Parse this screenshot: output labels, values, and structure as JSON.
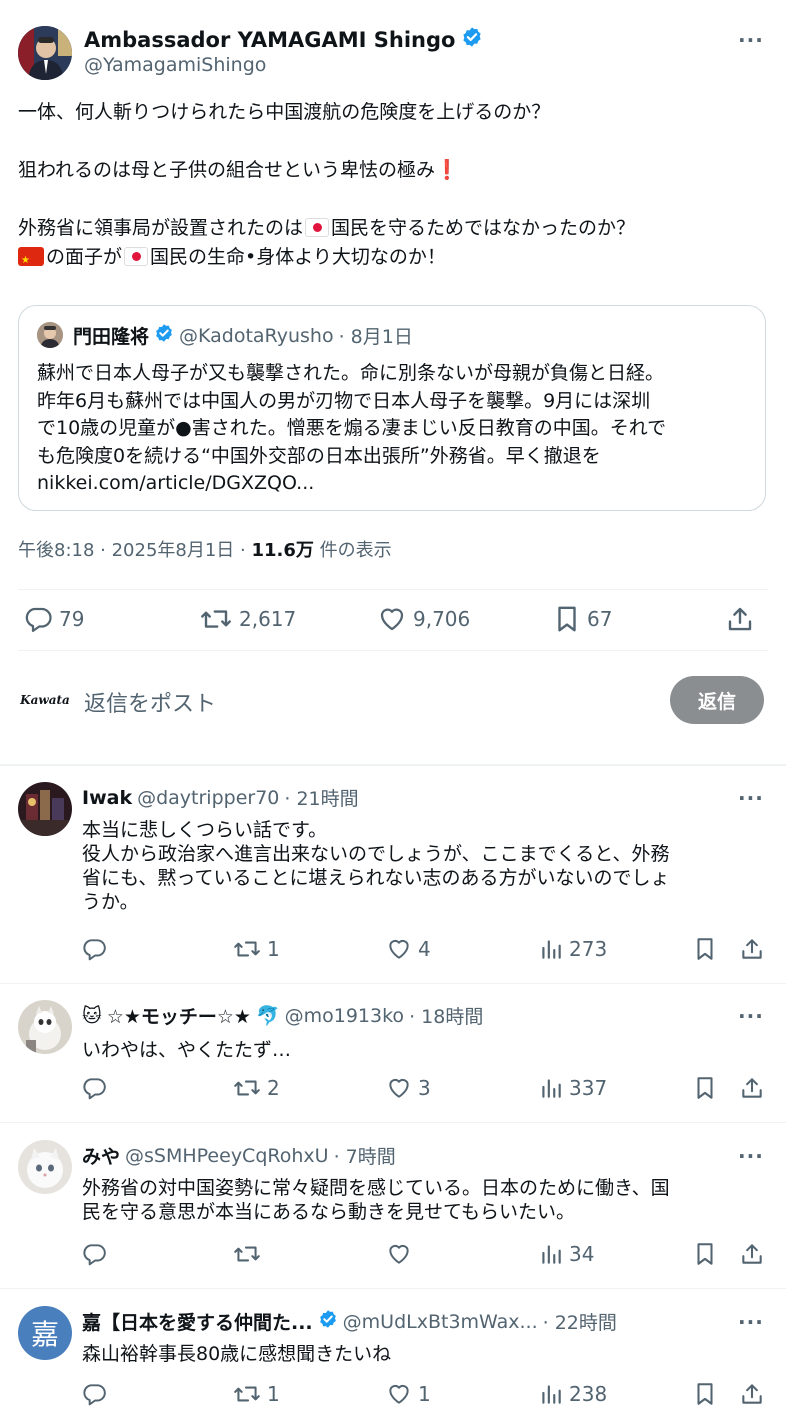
{
  "main_tweet": {
    "name": "Ambassador YAMAGAMI Shingo",
    "handle": "@YamagamiShingo",
    "line1": "一体、何人斬りつけられたら中国渡航の危険度を上げるのか？",
    "line2": "狙われるのは母と子供の組合せという卑怯の極み",
    "line2_mark": "❗",
    "line3a": "外務省に領事局が設置されたのは",
    "line3b": "国民を守るためではなかったのか？",
    "line4a": "の面子が",
    "line4b": "国民の生命•身体より大切なのか！",
    "quote": {
      "name": "門田隆将",
      "handle": "@KadotaRyusho",
      "date": "· 8月1日",
      "lines": [
        "蘇州で日本人母子が又も襲撃された。命に別条ないが母親が負傷と日経。",
        "昨年6月も蘇州では中国人の男が刃物で日本人母子を襲撃。9月には深圳",
        "で10歳の児童が●害された。憎悪を煽る凄まじい反日教育の中国。それで",
        "も危険度0を続ける“中国外交部の日本出張所”外務省。早く撤退を",
        "nikkei.com/article/DGXZQO..."
      ]
    },
    "meta": {
      "time": "午後8:18 · 2025年8月1日 ·",
      "views": "11.6万",
      "views_label": "件の表示"
    },
    "stats": {
      "replies": "79",
      "reposts": "2,617",
      "likes": "9,706",
      "bookmarks": "67"
    }
  },
  "reply_box": {
    "avatar_text": "Kawata",
    "placeholder": "返信をポスト",
    "button": "返信"
  },
  "replies": [
    {
      "name": "Iwak",
      "handle": "@daytripper70",
      "time": "· 21時間",
      "lines": [
        "本当に悲しくつらい話です。",
        "役人から政治家へ進言出来ないのでしょうが、ここまでくると、外務",
        "省にも、黙っていることに堪えられない志のある方がいないのでしょ",
        "うか。"
      ],
      "replies": "",
      "reposts": "1",
      "likes": "4",
      "views": "273"
    },
    {
      "name_prefix": "🐱",
      "name": "☆★モッチー☆★",
      "name_suffix": "🐬",
      "handle": "@mo1913ko",
      "time": "· 18時間",
      "lines": [
        "いわやは、やくたたず…"
      ],
      "replies": "",
      "reposts": "2",
      "likes": "3",
      "views": "337"
    },
    {
      "name": "みや",
      "handle": "@sSMHPeeyCqRohxU",
      "time": "· 7時間",
      "lines": [
        "外務省の対中国姿勢に常々疑問を感じている。日本のために働き、国",
        "民を守る意思が本当にあるなら動きを見せてもらいたい。"
      ],
      "replies": "",
      "reposts": "",
      "likes": "",
      "views": "34"
    },
    {
      "avatar_char": "嘉",
      "name": "嘉【日本を愛する仲間た...",
      "handle": "@mUdLxBt3mWax...",
      "time": "· 22時間",
      "lines": [
        "森山裕幹事長80歳に感想聞きたいね"
      ],
      "replies": "",
      "reposts": "1",
      "likes": "1",
      "views": "238"
    }
  ],
  "icons": {
    "more": "more-dots-icon",
    "verified": "verified-badge-icon",
    "reply": "reply-icon",
    "repost": "repost-icon",
    "like": "like-icon",
    "bookmark": "bookmark-icon",
    "share": "share-icon",
    "views": "views-icon"
  },
  "colors": {
    "verified": "#1d9bf0",
    "muted": "#536471",
    "reply_button": "#8b8e91"
  }
}
